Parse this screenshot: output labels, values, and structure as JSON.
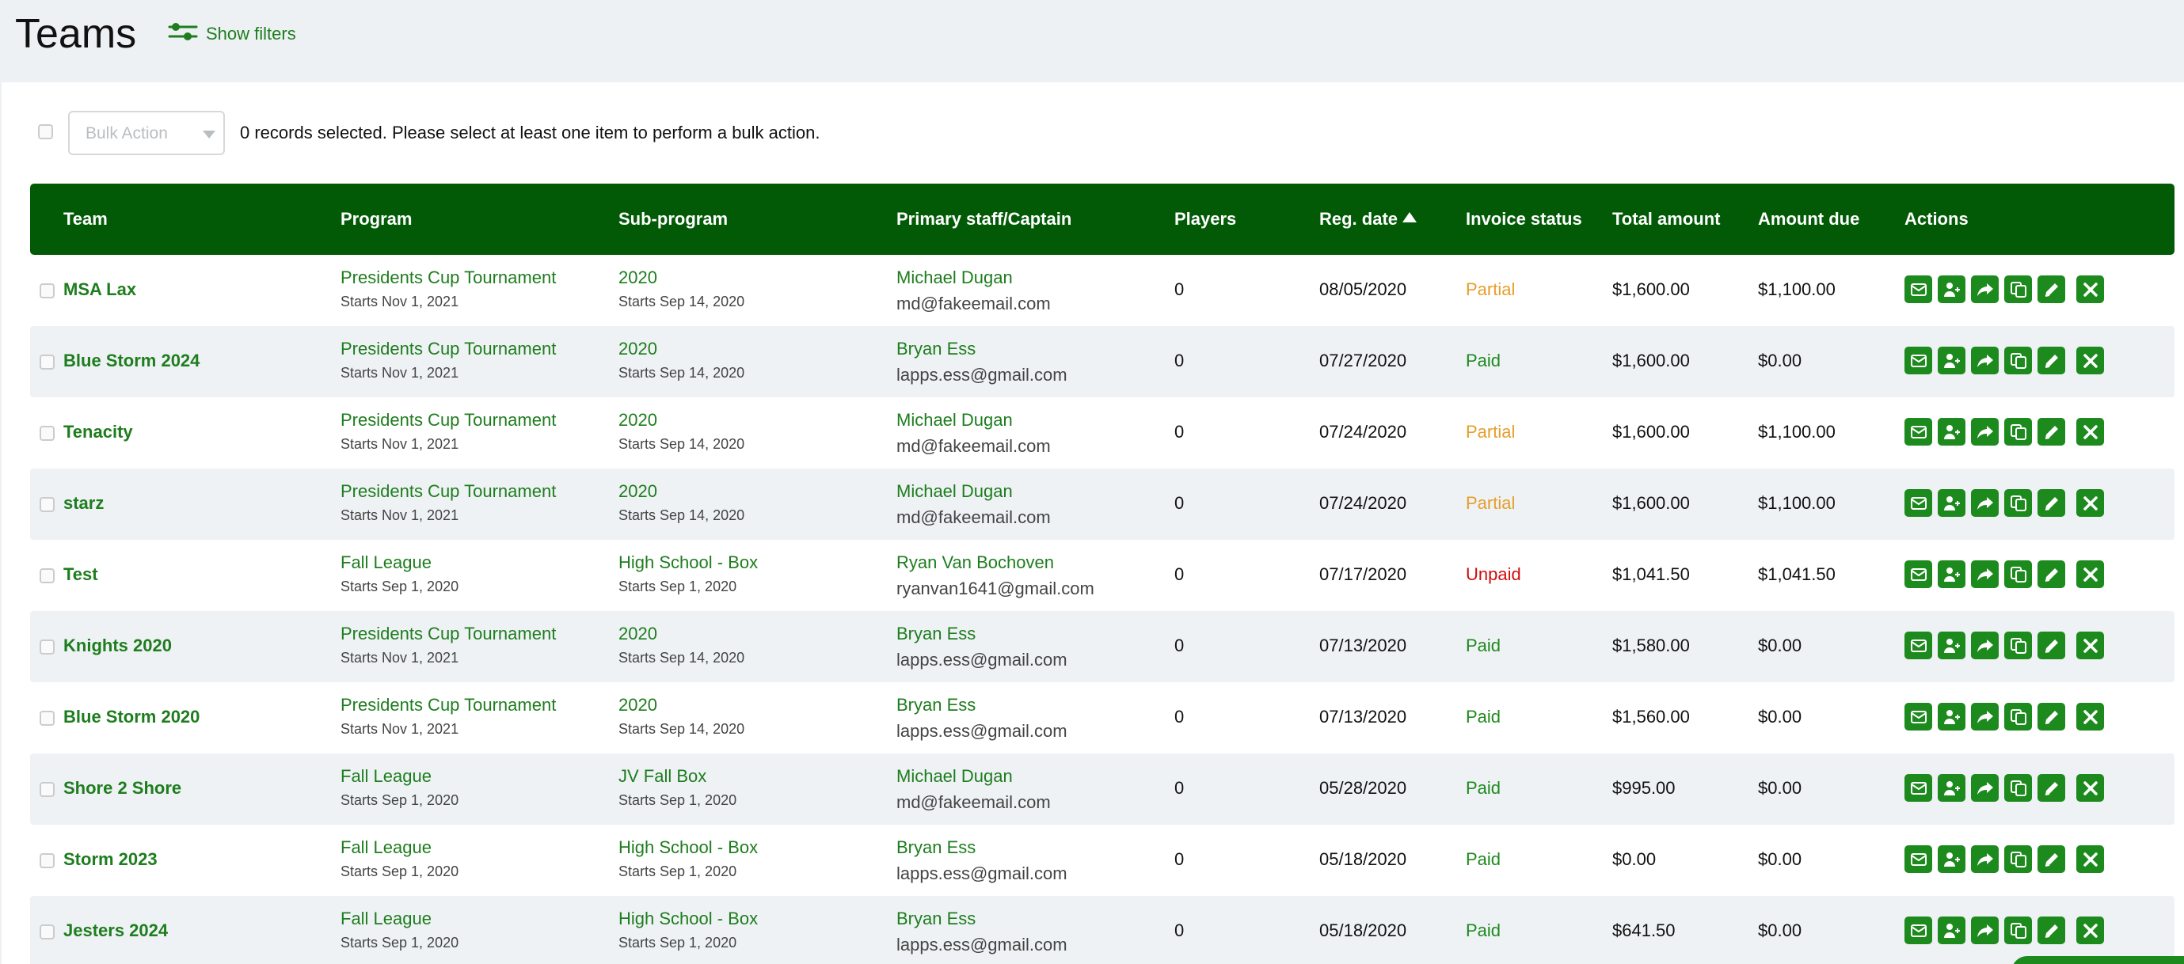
{
  "page": {
    "title": "Teams",
    "show_filters_label": "Show filters"
  },
  "bulk": {
    "select_label": "Bulk Action",
    "message": "0 records selected. Please select at least one item to perform a bulk action."
  },
  "columns": {
    "team": "Team",
    "program": "Program",
    "sub_program": "Sub-program",
    "staff": "Primary staff/Captain",
    "players": "Players",
    "reg_date": "Reg. date",
    "invoice_status": "Invoice status",
    "total_amount": "Total amount",
    "amount_due": "Amount due",
    "actions": "Actions"
  },
  "sort": {
    "column": "reg_date",
    "direction": "ascending-arrow-icon"
  },
  "colors": {
    "header_bg": "#025a06",
    "accent": "#1e7d1e",
    "paid": "#1e8a1e",
    "partial": "#e69e2c",
    "unpaid": "#d10b0b"
  },
  "action_icons": [
    "envelope-icon",
    "add-user-icon",
    "share-arrow-icon",
    "copy-icon",
    "pencil-icon",
    "delete-x-icon"
  ],
  "rows": [
    {
      "team": "MSA Lax",
      "program": "Presidents Cup Tournament",
      "program_start": "Starts Nov 1, 2021",
      "sub_program": "2020",
      "sub_start": "Starts Sep 14, 2020",
      "staff_name": "Michael Dugan",
      "staff_email": "md@fakeemail.com",
      "players": "0",
      "reg_date": "08/05/2020",
      "status": "Partial",
      "total": "$1,600.00",
      "due": "$1,100.00"
    },
    {
      "team": "Blue Storm 2024",
      "program": "Presidents Cup Tournament",
      "program_start": "Starts Nov 1, 2021",
      "sub_program": "2020",
      "sub_start": "Starts Sep 14, 2020",
      "staff_name": "Bryan Ess",
      "staff_email": "lapps.ess@gmail.com",
      "players": "0",
      "reg_date": "07/27/2020",
      "status": "Paid",
      "total": "$1,600.00",
      "due": "$0.00"
    },
    {
      "team": "Tenacity",
      "program": "Presidents Cup Tournament",
      "program_start": "Starts Nov 1, 2021",
      "sub_program": "2020",
      "sub_start": "Starts Sep 14, 2020",
      "staff_name": "Michael Dugan",
      "staff_email": "md@fakeemail.com",
      "players": "0",
      "reg_date": "07/24/2020",
      "status": "Partial",
      "total": "$1,600.00",
      "due": "$1,100.00"
    },
    {
      "team": "starz",
      "program": "Presidents Cup Tournament",
      "program_start": "Starts Nov 1, 2021",
      "sub_program": "2020",
      "sub_start": "Starts Sep 14, 2020",
      "staff_name": "Michael Dugan",
      "staff_email": "md@fakeemail.com",
      "players": "0",
      "reg_date": "07/24/2020",
      "status": "Partial",
      "total": "$1,600.00",
      "due": "$1,100.00"
    },
    {
      "team": "Test",
      "program": "Fall League",
      "program_start": "Starts Sep 1, 2020",
      "sub_program": "High School - Box",
      "sub_start": "Starts Sep 1, 2020",
      "staff_name": "Ryan Van Bochoven",
      "staff_email": "ryanvan1641@gmail.com",
      "players": "0",
      "reg_date": "07/17/2020",
      "status": "Unpaid",
      "total": "$1,041.50",
      "due": "$1,041.50"
    },
    {
      "team": "Knights 2020",
      "program": "Presidents Cup Tournament",
      "program_start": "Starts Nov 1, 2021",
      "sub_program": "2020",
      "sub_start": "Starts Sep 14, 2020",
      "staff_name": "Bryan Ess",
      "staff_email": "lapps.ess@gmail.com",
      "players": "0",
      "reg_date": "07/13/2020",
      "status": "Paid",
      "total": "$1,580.00",
      "due": "$0.00"
    },
    {
      "team": "Blue Storm 2020",
      "program": "Presidents Cup Tournament",
      "program_start": "Starts Nov 1, 2021",
      "sub_program": "2020",
      "sub_start": "Starts Sep 14, 2020",
      "staff_name": "Bryan Ess",
      "staff_email": "lapps.ess@gmail.com",
      "players": "0",
      "reg_date": "07/13/2020",
      "status": "Paid",
      "total": "$1,560.00",
      "due": "$0.00"
    },
    {
      "team": "Shore 2 Shore",
      "program": "Fall League",
      "program_start": "Starts Sep 1, 2020",
      "sub_program": "JV Fall Box",
      "sub_start": "Starts Sep 1, 2020",
      "staff_name": "Michael Dugan",
      "staff_email": "md@fakeemail.com",
      "players": "0",
      "reg_date": "05/28/2020",
      "status": "Paid",
      "total": "$995.00",
      "due": "$0.00"
    },
    {
      "team": "Storm 2023",
      "program": "Fall League",
      "program_start": "Starts Sep 1, 2020",
      "sub_program": "High School - Box",
      "sub_start": "Starts Sep 1, 2020",
      "staff_name": "Bryan Ess",
      "staff_email": "lapps.ess@gmail.com",
      "players": "0",
      "reg_date": "05/18/2020",
      "status": "Paid",
      "total": "$0.00",
      "due": "$0.00"
    },
    {
      "team": "Jesters 2024",
      "program": "Fall League",
      "program_start": "Starts Sep 1, 2020",
      "sub_program": "High School - Box",
      "sub_start": "Starts Sep 1, 2020",
      "staff_name": "Bryan Ess",
      "staff_email": "lapps.ess@gmail.com",
      "players": "0",
      "reg_date": "05/18/2020",
      "status": "Paid",
      "total": "$641.50",
      "due": "$0.00"
    }
  ]
}
